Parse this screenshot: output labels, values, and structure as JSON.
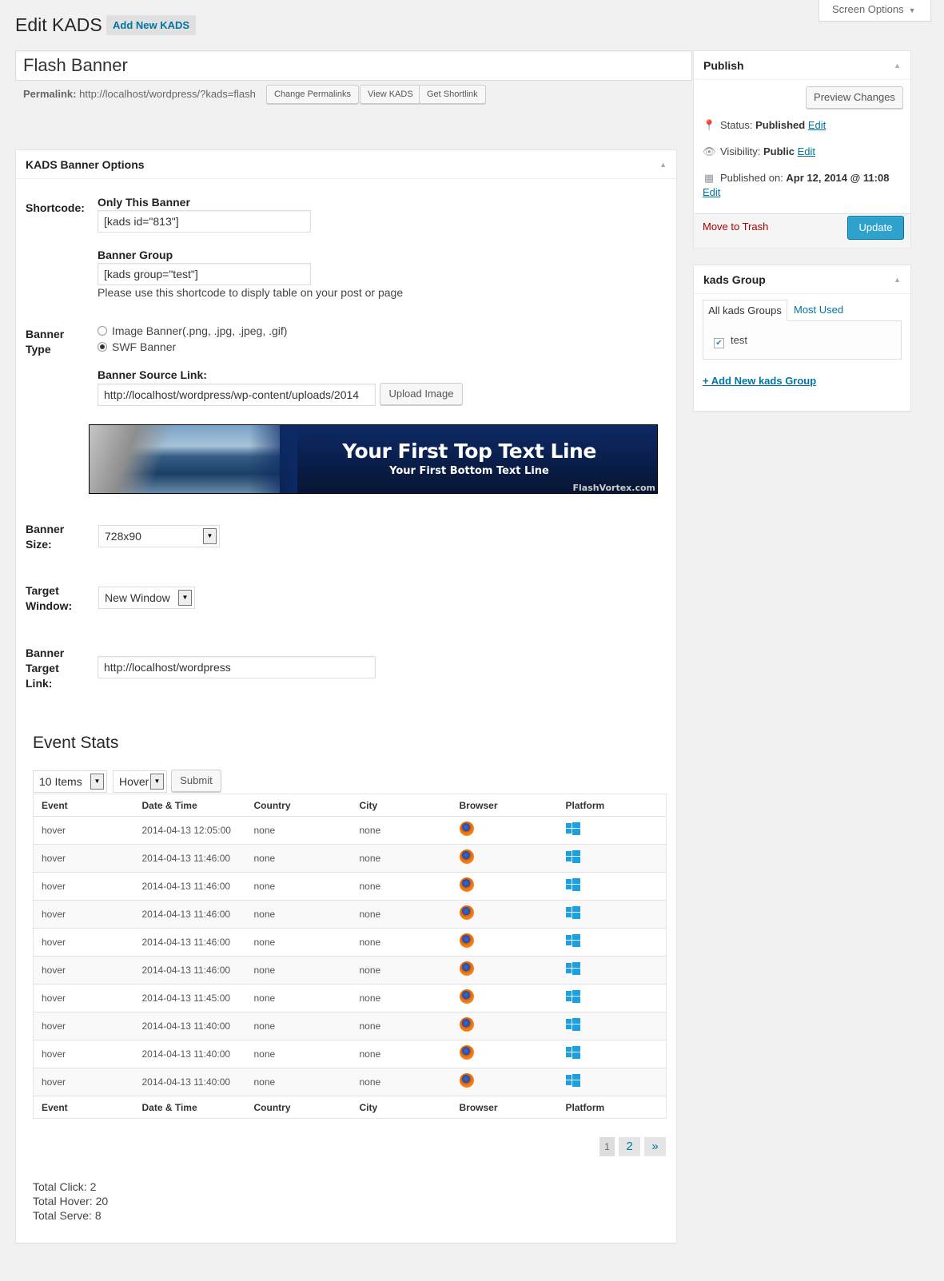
{
  "header": {
    "screen_options": "Screen Options",
    "title": "Edit KADS",
    "add_new": "Add New KADS"
  },
  "post": {
    "title": "Flash Banner",
    "permalink_label": "Permalink:",
    "permalink_url": "http://localhost/wordpress/?kads=flash",
    "change_permalinks": "Change Permalinks",
    "view": "View KADS",
    "shortlink": "Get Shortlink"
  },
  "banner_options": {
    "box_title": "KADS Banner Options",
    "shortcode_label": "Shortcode:",
    "only_this_label": "Only This Banner",
    "only_this_value": "[kads id=\"813\"]",
    "group_label": "Banner Group",
    "group_value": "[kads group=\"test\"]",
    "shortcode_help": "Please use this shortcode to disply table on your post or page",
    "type_label_1": "Banner",
    "type_label_2": "Type",
    "type_image": "Image Banner(.png, .jpg, .jpeg, .gif)",
    "type_swf": "SWF Banner",
    "type_selected": "SWF Banner",
    "source_label": "Banner Source Link:",
    "source_value": "http://localhost/wordpress/wp-content/uploads/2014",
    "upload_button": "Upload Image",
    "preview": {
      "top_line": "Your First Top Text Line",
      "bottom_line": "Your First Bottom Text Line",
      "watermark": "FlashVortex.com"
    },
    "size_label_1": "Banner",
    "size_label_2": "Size:",
    "size_value": "728x90",
    "target_label_1": "Target",
    "target_label_2": "Window:",
    "target_value": "New Window",
    "link_label_1": "Banner",
    "link_label_2": "Target",
    "link_label_3": "Link:",
    "link_value": "http://localhost/wordpress"
  },
  "event_stats": {
    "title": "Event Stats",
    "items_select": "10 Items",
    "event_select": "Hover",
    "submit": "Submit",
    "columns": [
      "Event",
      "Date & Time",
      "Country",
      "City",
      "Browser",
      "Platform"
    ],
    "rows": [
      {
        "event": "hover",
        "datetime": "2014-04-13 12:05:00",
        "country": "none",
        "city": "none",
        "browser": "firefox-icon",
        "platform": "windows-icon"
      },
      {
        "event": "hover",
        "datetime": "2014-04-13 11:46:00",
        "country": "none",
        "city": "none",
        "browser": "firefox-icon",
        "platform": "windows-icon"
      },
      {
        "event": "hover",
        "datetime": "2014-04-13 11:46:00",
        "country": "none",
        "city": "none",
        "browser": "firefox-icon",
        "platform": "windows-icon"
      },
      {
        "event": "hover",
        "datetime": "2014-04-13 11:46:00",
        "country": "none",
        "city": "none",
        "browser": "firefox-icon",
        "platform": "windows-icon"
      },
      {
        "event": "hover",
        "datetime": "2014-04-13 11:46:00",
        "country": "none",
        "city": "none",
        "browser": "firefox-icon",
        "platform": "windows-icon"
      },
      {
        "event": "hover",
        "datetime": "2014-04-13 11:46:00",
        "country": "none",
        "city": "none",
        "browser": "firefox-icon",
        "platform": "windows-icon"
      },
      {
        "event": "hover",
        "datetime": "2014-04-13 11:45:00",
        "country": "none",
        "city": "none",
        "browser": "firefox-icon",
        "platform": "windows-icon"
      },
      {
        "event": "hover",
        "datetime": "2014-04-13 11:40:00",
        "country": "none",
        "city": "none",
        "browser": "firefox-icon",
        "platform": "windows-icon"
      },
      {
        "event": "hover",
        "datetime": "2014-04-13 11:40:00",
        "country": "none",
        "city": "none",
        "browser": "firefox-icon",
        "platform": "windows-icon"
      },
      {
        "event": "hover",
        "datetime": "2014-04-13 11:40:00",
        "country": "none",
        "city": "none",
        "browser": "firefox-icon",
        "platform": "windows-icon"
      }
    ],
    "pagination": {
      "current": "1",
      "next_page": "2",
      "next": "»"
    },
    "total_click": "Total Click: 2",
    "total_hover": "Total Hover: 20",
    "total_serve": "Total Serve: 8"
  },
  "publish": {
    "box_title": "Publish",
    "preview_changes": "Preview Changes",
    "status_label": "Status:",
    "status_value": "Published",
    "visibility_label": "Visibility:",
    "visibility_value": "Public",
    "published_label": "Published on:",
    "published_value": "Apr 12, 2014 @ 11:08",
    "edit": "Edit",
    "trash": "Move to Trash",
    "update": "Update"
  },
  "group_box": {
    "box_title": "kads Group",
    "tab_all": "All kads Groups",
    "tab_most_used": "Most Used",
    "items": [
      {
        "label": "test",
        "checked": true
      }
    ],
    "add_new": "+ Add New kads Group"
  },
  "colors": {
    "accent": "#0074a2",
    "update_button": "#2ea2cc",
    "trash": "#a00000",
    "windows": "#1ba1e2"
  }
}
